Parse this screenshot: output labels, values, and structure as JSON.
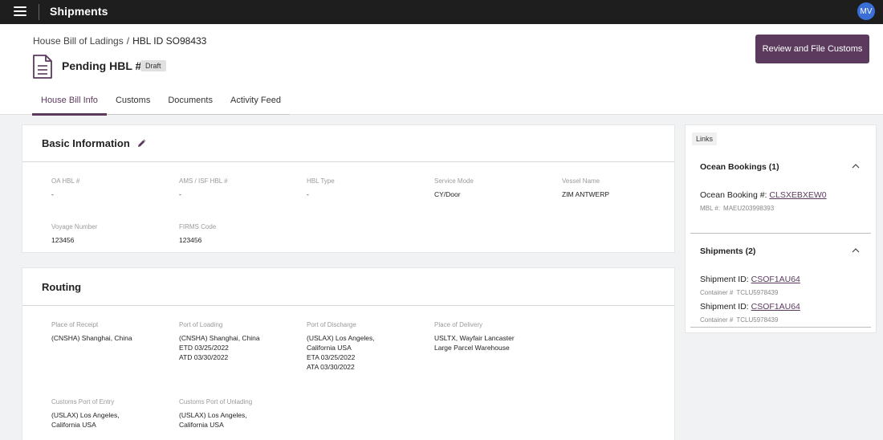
{
  "topbar": {
    "title": "Shipments",
    "avatar": "MV"
  },
  "breadcrumb": {
    "parent": "House Bill of Ladings",
    "separator": "/",
    "current": "HBL ID SO98433"
  },
  "page": {
    "title": "Pending HBL #",
    "badge": "Draft",
    "primary_action": "Review and File Customs"
  },
  "tabs": [
    {
      "label": "House Bill Info",
      "active": true
    },
    {
      "label": "Customs",
      "active": false
    },
    {
      "label": "Documents",
      "active": false
    },
    {
      "label": "Activity Feed",
      "active": false
    }
  ],
  "basic": {
    "title": "Basic Information",
    "fields": [
      {
        "label": "OA HBL #",
        "value": "-"
      },
      {
        "label": "AMS / ISF HBL #",
        "value": "-"
      },
      {
        "label": "HBL Type",
        "value": "-"
      },
      {
        "label": "Service Mode",
        "value": "CY/Door"
      },
      {
        "label": "Vessel Name",
        "value": "ZIM ANTWERP"
      },
      {
        "label": "Voyage Number",
        "value": "123456"
      },
      {
        "label": "FIRMS Code",
        "value": "123456"
      }
    ]
  },
  "routing": {
    "title": "Routing",
    "fields": [
      {
        "label": "Place of Receipt",
        "value": "(CNSHA) Shanghai, China"
      },
      {
        "label": "Port of Loading",
        "value": "(CNSHA) Shanghai, China\nETD 03/25/2022\nATD 03/30/2022"
      },
      {
        "label": "Port of Discharge",
        "value": "(USLAX) Los Angeles,\nCalifornia USA\nETA 03/25/2022\nATA 03/30/2022"
      },
      {
        "label": "Place of Delivery",
        "value": "USLTX, Wayfair Lancaster\nLarge Parcel Warehouse"
      },
      {
        "label": "Customs Port of Entry",
        "value": "(USLAX) Los Angeles,\nCalifornia USA"
      },
      {
        "label": "Customs Port of Unlading",
        "value": "(USLAX) Los Angeles,\nCalifornia USA"
      }
    ]
  },
  "links": {
    "tag": "Links",
    "ocean": {
      "title": "Ocean Bookings (1)",
      "booking_label": "Ocean Booking #: ",
      "booking_id": "CLSXEBXEW0",
      "mbl_label": "MBL #:",
      "mbl_value": "MAEU203998393"
    },
    "shipments": {
      "title": "Shipments (2)",
      "items": [
        {
          "label": "Shipment ID: ",
          "id": "CSOF1AU64",
          "container_label": "Container #",
          "container": "TCLU5978439"
        },
        {
          "label": "Shipment ID: ",
          "id": "CSOF1AU64",
          "container_label": "Container #",
          "container": "TCLU5978439"
        }
      ]
    }
  },
  "colors": {
    "accent": "#5b3a5e",
    "topbar": "#1e1e1e",
    "avatar": "#3a6fd8"
  }
}
